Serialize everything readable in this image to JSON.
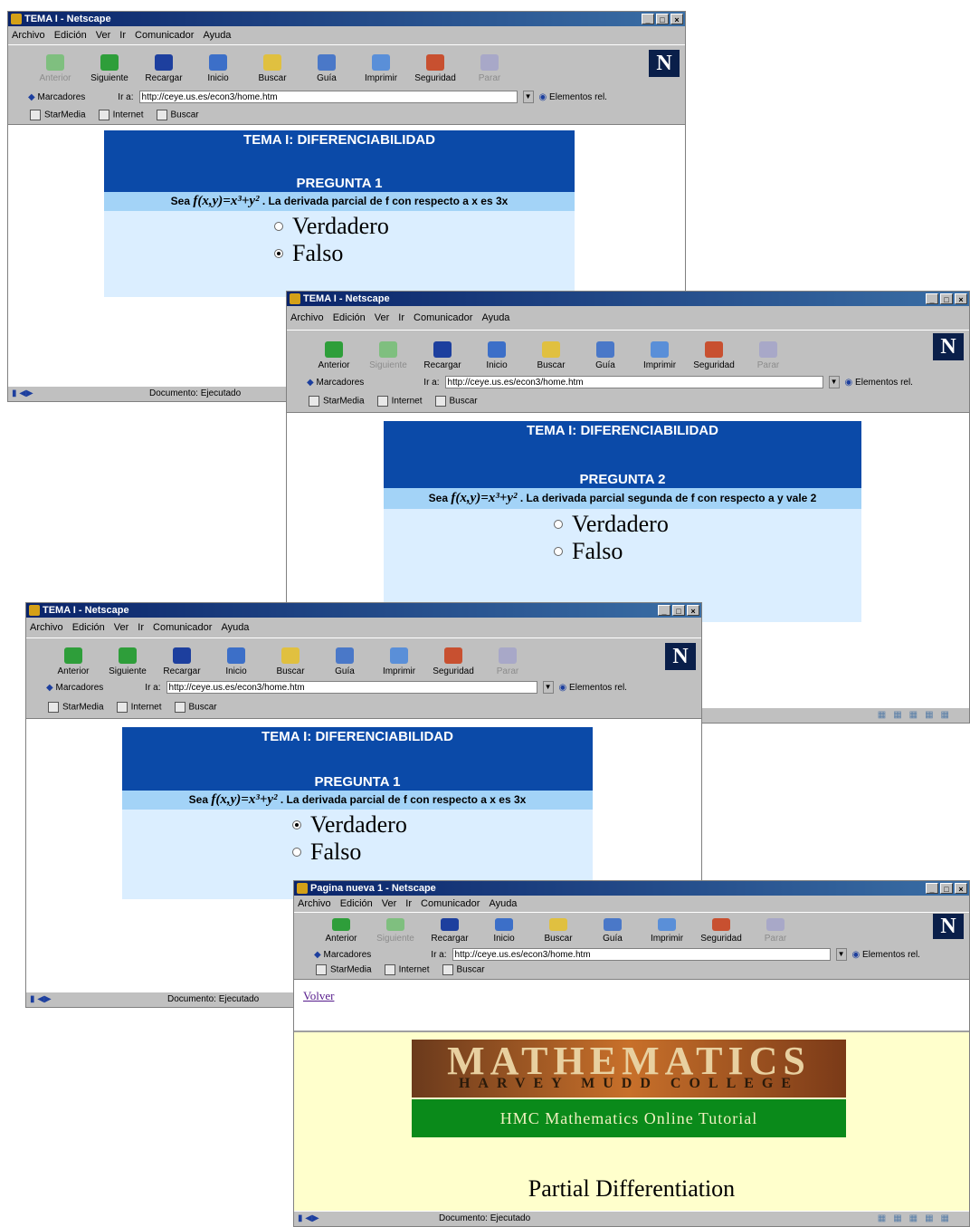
{
  "windows": [
    {
      "title": "TEMA I - Netscape",
      "menu": [
        "Archivo",
        "Edición",
        "Ver",
        "Ir",
        "Comunicador",
        "Ayuda"
      ],
      "toolbar": [
        {
          "label": "Anterior",
          "disabled": true
        },
        {
          "label": "Siguiente"
        },
        {
          "label": "Recargar"
        },
        {
          "label": "Inicio"
        },
        {
          "label": "Buscar"
        },
        {
          "label": "Guía"
        },
        {
          "label": "Imprimir"
        },
        {
          "label": "Seguridad"
        },
        {
          "label": "Parar",
          "disabled": true
        }
      ],
      "bookmarks_label": "Marcadores",
      "location_label": "Ir a:",
      "url": "http://ceye.us.es/econ3/home.htm",
      "related_label": "Elementos rel.",
      "personal": [
        "StarMedia",
        "Internet",
        "Buscar"
      ],
      "status": "Documento: Ejecutado",
      "tema": "TEMA I: DIFERENCIABILIDAD",
      "pregunta": "PREGUNTA 1",
      "q_prefix": "Sea",
      "q_formula": "f(x,y)=x³+y²",
      "q_text": ". La derivada parcial de f con respecto a x es 3x",
      "options": [
        "Verdadero",
        "Falso"
      ]
    },
    {
      "title": "TEMA I - Netscape",
      "menu": [
        "Archivo",
        "Edición",
        "Ver",
        "Ir",
        "Comunicador",
        "Ayuda"
      ],
      "toolbar": [
        {
          "label": "Anterior"
        },
        {
          "label": "Siguiente",
          "disabled": true
        },
        {
          "label": "Recargar"
        },
        {
          "label": "Inicio"
        },
        {
          "label": "Buscar"
        },
        {
          "label": "Guía"
        },
        {
          "label": "Imprimir"
        },
        {
          "label": "Seguridad"
        },
        {
          "label": "Parar",
          "disabled": true
        }
      ],
      "bookmarks_label": "Marcadores",
      "location_label": "Ir a:",
      "url": "http://ceye.us.es/econ3/home.htm",
      "related_label": "Elementos rel.",
      "personal": [
        "StarMedia",
        "Internet",
        "Buscar"
      ],
      "tema": "TEMA I: DIFERENCIABILIDAD",
      "pregunta": "PREGUNTA 2",
      "q_prefix": "Sea",
      "q_formula": "f(x,y)=x³+y²",
      "q_text": ". La derivada parcial segunda de f con respecto a y vale 2",
      "options": [
        "Verdadero",
        "Falso"
      ]
    },
    {
      "title": "TEMA I - Netscape",
      "menu": [
        "Archivo",
        "Edición",
        "Ver",
        "Ir",
        "Comunicador",
        "Ayuda"
      ],
      "toolbar": [
        {
          "label": "Anterior"
        },
        {
          "label": "Siguiente"
        },
        {
          "label": "Recargar"
        },
        {
          "label": "Inicio"
        },
        {
          "label": "Buscar"
        },
        {
          "label": "Guía"
        },
        {
          "label": "Imprimir"
        },
        {
          "label": "Seguridad"
        },
        {
          "label": "Parar",
          "disabled": true
        }
      ],
      "bookmarks_label": "Marcadores",
      "location_label": "Ir a:",
      "url": "http://ceye.us.es/econ3/home.htm",
      "related_label": "Elementos rel.",
      "personal": [
        "StarMedia",
        "Internet",
        "Buscar"
      ],
      "status": "Documento: Ejecutado",
      "tema": "TEMA I: DIFERENCIABILIDAD",
      "pregunta": "PREGUNTA 1",
      "q_prefix": "Sea",
      "q_formula": "f(x,y)=x³+y²",
      "q_text": ". La derivada parcial de f con respecto a x es 3x",
      "options": [
        "Verdadero",
        "Falso"
      ]
    },
    {
      "title": "Pagina nueva 1 - Netscape",
      "menu": [
        "Archivo",
        "Edición",
        "Ver",
        "Ir",
        "Comunicador",
        "Ayuda"
      ],
      "toolbar": [
        {
          "label": "Anterior"
        },
        {
          "label": "Siguiente",
          "disabled": true
        },
        {
          "label": "Recargar"
        },
        {
          "label": "Inicio"
        },
        {
          "label": "Buscar"
        },
        {
          "label": "Guía"
        },
        {
          "label": "Imprimir"
        },
        {
          "label": "Seguridad"
        },
        {
          "label": "Parar",
          "disabled": true
        }
      ],
      "bookmarks_label": "Marcadores",
      "location_label": "Ir a:",
      "url": "http://ceye.us.es/econ3/home.htm",
      "related_label": "Elementos rel.",
      "personal": [
        "StarMedia",
        "Internet",
        "Buscar"
      ],
      "status": "Documento: Ejecutado",
      "back_link": "Volver",
      "logo_main": "MATHEMATICS",
      "logo_sub": "HARVEY MUDD COLLEGE",
      "tutorial_banner": "HMC Mathematics Online Tutorial",
      "page_heading": "Partial Differentiation"
    }
  ],
  "colors": {
    "title_bar": "#0a246a",
    "panel_header": "#0b4aa8",
    "panel_question": "#a3d3f7",
    "panel_body": "#dbeeff",
    "hmc_green": "#0a8a1a",
    "hmc_bg": "#ffffcc"
  }
}
